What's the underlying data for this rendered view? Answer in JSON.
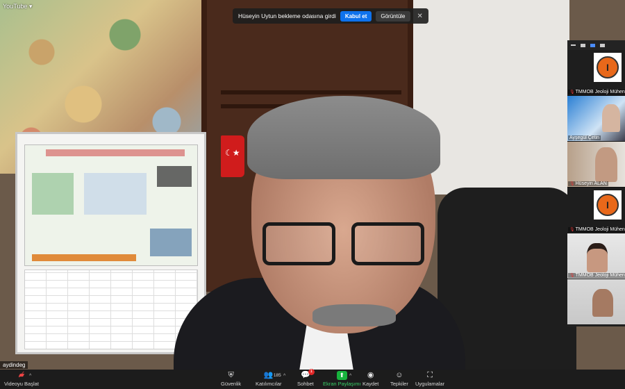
{
  "video": {
    "source_label": "YouTube ▾",
    "speaker_name": "aydindeg"
  },
  "notification": {
    "message": "Hüseyin Uytun bekleme odasına girdi",
    "accept_label": "Kabul et",
    "view_label": "Görüntüle",
    "close_icon": "close-icon"
  },
  "gallery": {
    "tiles": [
      {
        "label": "TMMOB Jeoloji Mühen",
        "kind": "logo"
      },
      {
        "label": "Ayşegül Çetin",
        "kind": "video"
      },
      {
        "label": "Hüseyin ALAN",
        "kind": "video"
      },
      {
        "label": "TMMOB Jeoloji Mühen",
        "kind": "logo"
      },
      {
        "label": "TMMOB Jeoloji Mühen",
        "kind": "video"
      },
      {
        "label": "",
        "kind": "video"
      }
    ]
  },
  "toolbar": {
    "video_label": "Videoyu Başlat",
    "security_label": "Güvenlik",
    "participants_label": "Katılımcılar",
    "participants_count": "185",
    "chat_label": "Sohbet",
    "chat_badge": "1",
    "share_label": "Ekran Paylaşımı",
    "record_label": "Kaydet",
    "reactions_label": "Tepkiler",
    "apps_label": "Uygulamalar"
  },
  "colors": {
    "accent": "#0e72ed",
    "share_green": "#17b33d",
    "badge_red": "#e02828"
  }
}
